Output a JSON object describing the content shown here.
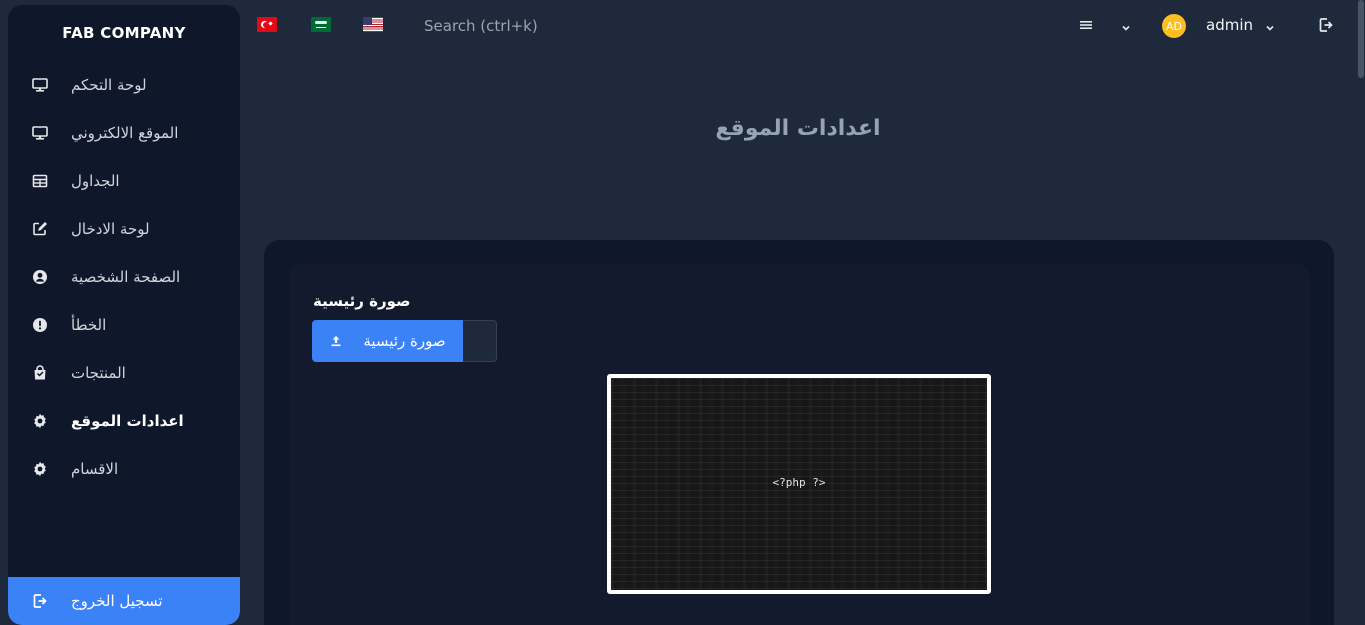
{
  "brand": "FAB COMPANY",
  "sidebar": {
    "items": [
      {
        "label": "لوحة التحكم",
        "icon": "monitor-icon"
      },
      {
        "label": "الموقع الالكتروني",
        "icon": "monitor-icon"
      },
      {
        "label": "الجداول",
        "icon": "table-icon"
      },
      {
        "label": "لوحة الادخال",
        "icon": "edit-icon"
      },
      {
        "label": "الصفحة الشخصية",
        "icon": "user-circle-icon"
      },
      {
        "label": "الخطأ",
        "icon": "alert-icon"
      },
      {
        "label": "المنتجات",
        "icon": "shopping-bag-icon"
      },
      {
        "label": "اعدادات الموقع",
        "icon": "gear-icon",
        "active": true
      },
      {
        "label": "الاقسام",
        "icon": "gear-icon"
      }
    ],
    "logout": "تسجيل الخروج"
  },
  "topbar": {
    "languages": [
      "tr-flag",
      "sa-flag",
      "us-flag"
    ],
    "search_placeholder": "Search (ctrl+k)",
    "avatar_initials": "AD",
    "username": "admin"
  },
  "main": {
    "page_title": "اعدادات الموقع",
    "field_label": "صورة رئيسية",
    "upload_label": "صورة رئيسية",
    "preview_text": "<?php ?>"
  },
  "colors": {
    "accent": "#3b82f6",
    "sidebar_bg": "#0f172a",
    "page_bg": "#1e293b",
    "avatar": "#fbbf24"
  }
}
